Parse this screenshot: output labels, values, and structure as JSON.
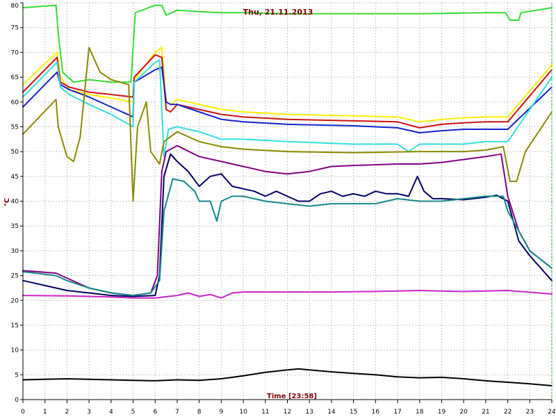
{
  "chart_data": {
    "type": "line",
    "title": "Thu, 21.11.2013",
    "xlabel": "Time [23:58]",
    "ylabel": "°C",
    "xlim": [
      0,
      24
    ],
    "ylim": [
      0,
      80
    ],
    "x_ticks": [
      0,
      1,
      2,
      3,
      4,
      5,
      6,
      7,
      8,
      9,
      10,
      11,
      12,
      13,
      14,
      15,
      16,
      17,
      18,
      19,
      20,
      21,
      22,
      23,
      24
    ],
    "y_ticks": [
      0,
      5,
      10,
      15,
      20,
      25,
      30,
      35,
      40,
      45,
      50,
      55,
      60,
      65,
      70,
      75,
      80
    ],
    "grid": true,
    "background": "#ffffff",
    "series": [
      {
        "color": "#33dd33",
        "points": [
          [
            0,
            79
          ],
          [
            1.5,
            79.5
          ],
          [
            1.6,
            74
          ],
          [
            1.8,
            66
          ],
          [
            2.05,
            65
          ],
          [
            2.3,
            64
          ],
          [
            3,
            64.5
          ],
          [
            4,
            64
          ],
          [
            4.9,
            64
          ],
          [
            5.1,
            78
          ],
          [
            6,
            79.5
          ],
          [
            6.3,
            79.5
          ],
          [
            6.5,
            77.5
          ],
          [
            7,
            78.5
          ],
          [
            8,
            78.2
          ],
          [
            9,
            78
          ],
          [
            10,
            78
          ],
          [
            12,
            77.8
          ],
          [
            15,
            77.8
          ],
          [
            18,
            77.8
          ],
          [
            21,
            78
          ],
          [
            21.9,
            78
          ],
          [
            22.1,
            76.5
          ],
          [
            22.5,
            76.5
          ],
          [
            22.6,
            78
          ],
          [
            24,
            79
          ]
        ]
      },
      {
        "color": "#ffee00",
        "points": [
          [
            0,
            63.5
          ],
          [
            1.55,
            70
          ],
          [
            1.7,
            65
          ],
          [
            2.1,
            62.5
          ],
          [
            3,
            61.5
          ],
          [
            4,
            60.8
          ],
          [
            5,
            60
          ],
          [
            5.05,
            64.5
          ],
          [
            6,
            70
          ],
          [
            6.3,
            71
          ],
          [
            6.5,
            60
          ],
          [
            6.7,
            59.5
          ],
          [
            7,
            60.5
          ],
          [
            8,
            59.5
          ],
          [
            9,
            58.5
          ],
          [
            10,
            58
          ],
          [
            12,
            57.5
          ],
          [
            15,
            57.2
          ],
          [
            17,
            57
          ],
          [
            18,
            56
          ],
          [
            19,
            56.5
          ],
          [
            20,
            56.8
          ],
          [
            21,
            57
          ],
          [
            22,
            57
          ],
          [
            24,
            67.5
          ]
        ]
      },
      {
        "color": "#cc1111",
        "points": [
          [
            0,
            62
          ],
          [
            1.55,
            69
          ],
          [
            1.7,
            64
          ],
          [
            2.1,
            63
          ],
          [
            3,
            62
          ],
          [
            4,
            61.5
          ],
          [
            5,
            61
          ],
          [
            5.05,
            65
          ],
          [
            6,
            69.5
          ],
          [
            6.3,
            69
          ],
          [
            6.5,
            58.5
          ],
          [
            6.7,
            58
          ],
          [
            7,
            59.5
          ],
          [
            8,
            58.5
          ],
          [
            9,
            57.5
          ],
          [
            10,
            57
          ],
          [
            12,
            56.5
          ],
          [
            15,
            56.2
          ],
          [
            17,
            56
          ],
          [
            18,
            54.8
          ],
          [
            19,
            55.5
          ],
          [
            20,
            55.8
          ],
          [
            21,
            56
          ],
          [
            22,
            56
          ],
          [
            24,
            66.5
          ]
        ]
      },
      {
        "color": "#1122cc",
        "points": [
          [
            0,
            59
          ],
          [
            1.55,
            66
          ],
          [
            1.7,
            63.5
          ],
          [
            2.1,
            62.5
          ],
          [
            3,
            61
          ],
          [
            4,
            59
          ],
          [
            5,
            57
          ],
          [
            5.05,
            64
          ],
          [
            6,
            66.5
          ],
          [
            6.3,
            67
          ],
          [
            6.5,
            60
          ],
          [
            6.7,
            59.5
          ],
          [
            7,
            59.5
          ],
          [
            8,
            58
          ],
          [
            9,
            56.5
          ],
          [
            10,
            56
          ],
          [
            12,
            55.5
          ],
          [
            15,
            55.2
          ],
          [
            17,
            54.8
          ],
          [
            18,
            53.8
          ],
          [
            19,
            54.2
          ],
          [
            20,
            54.5
          ],
          [
            21,
            54.5
          ],
          [
            22,
            54.5
          ],
          [
            24,
            63
          ]
        ]
      },
      {
        "color": "#33dddd",
        "points": [
          [
            0,
            61
          ],
          [
            1.55,
            68
          ],
          [
            1.7,
            63
          ],
          [
            2.1,
            61.5
          ],
          [
            3,
            59.5
          ],
          [
            4,
            57.5
          ],
          [
            5,
            55
          ],
          [
            5.05,
            64
          ],
          [
            6,
            68
          ],
          [
            6.2,
            68.5
          ],
          [
            6.4,
            49
          ],
          [
            6.6,
            54.5
          ],
          [
            7,
            55
          ],
          [
            8,
            54
          ],
          [
            9,
            52.5
          ],
          [
            10,
            52.5
          ],
          [
            12,
            52
          ],
          [
            15,
            51.5
          ],
          [
            17,
            51.5
          ],
          [
            17.5,
            50
          ],
          [
            18,
            51.5
          ],
          [
            20,
            51.5
          ],
          [
            21,
            52
          ],
          [
            22,
            52
          ],
          [
            24,
            65
          ]
        ]
      },
      {
        "color": "#888800",
        "points": [
          [
            0,
            53.5
          ],
          [
            1.5,
            60.5
          ],
          [
            1.6,
            55
          ],
          [
            2,
            49
          ],
          [
            2.3,
            48
          ],
          [
            2.6,
            53
          ],
          [
            3,
            71
          ],
          [
            3.5,
            66
          ],
          [
            4,
            64.5
          ],
          [
            4.8,
            63.5
          ],
          [
            5,
            40
          ],
          [
            5.2,
            55
          ],
          [
            5.6,
            60
          ],
          [
            5.8,
            50
          ],
          [
            6.2,
            47.5
          ],
          [
            6.4,
            52
          ],
          [
            7,
            54
          ],
          [
            8,
            52
          ],
          [
            9,
            51
          ],
          [
            10,
            50.5
          ],
          [
            12,
            50
          ],
          [
            15,
            49.8
          ],
          [
            18,
            50
          ],
          [
            20,
            50
          ],
          [
            21,
            50.3
          ],
          [
            21.8,
            51
          ],
          [
            22.1,
            44
          ],
          [
            22.4,
            44
          ],
          [
            22.8,
            50
          ],
          [
            24,
            58
          ]
        ]
      },
      {
        "color": "#800080",
        "points": [
          [
            0,
            26
          ],
          [
            1.5,
            25.5
          ],
          [
            2,
            24.5
          ],
          [
            3,
            22.5
          ],
          [
            4,
            21.5
          ],
          [
            5,
            21
          ],
          [
            5.8,
            21.5
          ],
          [
            6.1,
            25
          ],
          [
            6.3,
            46
          ],
          [
            6.5,
            50
          ],
          [
            7,
            51.2
          ],
          [
            8,
            49
          ],
          [
            9,
            48
          ],
          [
            10,
            47
          ],
          [
            11,
            46
          ],
          [
            12,
            45.5
          ],
          [
            13,
            46
          ],
          [
            14,
            47
          ],
          [
            15,
            47.2
          ],
          [
            17,
            47.5
          ],
          [
            18,
            47.5
          ],
          [
            19,
            47.8
          ],
          [
            21,
            49
          ],
          [
            21.7,
            49.5
          ],
          [
            22,
            41
          ],
          [
            22.5,
            34
          ],
          [
            23,
            30
          ],
          [
            24,
            26.5
          ]
        ]
      },
      {
        "color": "#000066",
        "points": [
          [
            0,
            24
          ],
          [
            1.5,
            22.5
          ],
          [
            2,
            22
          ],
          [
            3,
            21.5
          ],
          [
            4,
            21
          ],
          [
            5,
            20.8
          ],
          [
            6,
            21
          ],
          [
            6.2,
            25
          ],
          [
            6.4,
            45
          ],
          [
            6.7,
            49.5
          ],
          [
            7,
            48
          ],
          [
            7.5,
            46
          ],
          [
            8,
            43
          ],
          [
            8.5,
            45
          ],
          [
            9,
            45.5
          ],
          [
            9.5,
            43
          ],
          [
            10,
            42.5
          ],
          [
            10.5,
            42
          ],
          [
            11,
            41
          ],
          [
            11.5,
            42
          ],
          [
            12,
            41
          ],
          [
            12.5,
            40
          ],
          [
            13,
            40
          ],
          [
            13.5,
            41.5
          ],
          [
            14,
            42
          ],
          [
            14.5,
            41
          ],
          [
            15,
            41.5
          ],
          [
            15.5,
            41
          ],
          [
            16,
            42
          ],
          [
            16.5,
            41.5
          ],
          [
            17,
            41.5
          ],
          [
            17.5,
            41
          ],
          [
            17.9,
            45
          ],
          [
            18.2,
            42
          ],
          [
            18.6,
            40.5
          ],
          [
            19,
            40.5
          ],
          [
            20,
            40.3
          ],
          [
            21,
            40.8
          ],
          [
            21.5,
            41.2
          ],
          [
            22,
            40
          ],
          [
            22.5,
            32
          ],
          [
            23,
            29
          ],
          [
            24,
            24
          ]
        ]
      },
      {
        "color": "#118888",
        "points": [
          [
            0,
            25.8
          ],
          [
            1.5,
            25
          ],
          [
            2,
            24
          ],
          [
            3,
            22.5
          ],
          [
            4,
            21.5
          ],
          [
            5,
            21
          ],
          [
            5.8,
            21.5
          ],
          [
            6.2,
            24
          ],
          [
            6.4,
            38
          ],
          [
            6.8,
            44.5
          ],
          [
            7.3,
            44
          ],
          [
            7.8,
            42
          ],
          [
            8,
            40
          ],
          [
            8.5,
            40
          ],
          [
            8.8,
            36
          ],
          [
            9,
            40
          ],
          [
            9.5,
            41
          ],
          [
            10,
            41
          ],
          [
            11,
            40
          ],
          [
            12,
            39.5
          ],
          [
            13,
            39
          ],
          [
            14,
            39.5
          ],
          [
            15,
            39.5
          ],
          [
            16,
            39.5
          ],
          [
            17,
            40.5
          ],
          [
            18,
            40
          ],
          [
            19,
            40
          ],
          [
            20,
            40.5
          ],
          [
            21,
            41
          ],
          [
            21.8,
            41
          ],
          [
            22,
            38
          ],
          [
            22.5,
            34
          ],
          [
            23,
            30
          ],
          [
            24,
            26.5
          ]
        ]
      },
      {
        "color": "#cc22cc",
        "points": [
          [
            0,
            21
          ],
          [
            2,
            20.9
          ],
          [
            4,
            20.7
          ],
          [
            5,
            20.5
          ],
          [
            6,
            20.5
          ],
          [
            7,
            21
          ],
          [
            7.5,
            21.5
          ],
          [
            8,
            20.8
          ],
          [
            8.5,
            21.2
          ],
          [
            9,
            20.5
          ],
          [
            9.5,
            21.5
          ],
          [
            10,
            21.7
          ],
          [
            12,
            21.7
          ],
          [
            14,
            21.7
          ],
          [
            16,
            21.8
          ],
          [
            18,
            22
          ],
          [
            20,
            21.8
          ],
          [
            22,
            22
          ],
          [
            24,
            21.3
          ]
        ]
      },
      {
        "color": "#000000",
        "points": [
          [
            0,
            4
          ],
          [
            2,
            4.2
          ],
          [
            4,
            4
          ],
          [
            5,
            3.9
          ],
          [
            6,
            3.8
          ],
          [
            7,
            4
          ],
          [
            8,
            3.9
          ],
          [
            9,
            4.2
          ],
          [
            10,
            4.8
          ],
          [
            11,
            5.5
          ],
          [
            12,
            6
          ],
          [
            12.5,
            6.2
          ],
          [
            13,
            6
          ],
          [
            14,
            5.6
          ],
          [
            15,
            5.3
          ],
          [
            16,
            5
          ],
          [
            17,
            4.6
          ],
          [
            18,
            4.4
          ],
          [
            19,
            4.5
          ],
          [
            20,
            4.2
          ],
          [
            21,
            3.8
          ],
          [
            22,
            3.5
          ],
          [
            23,
            3.2
          ],
          [
            24,
            2.8
          ]
        ]
      }
    ]
  }
}
